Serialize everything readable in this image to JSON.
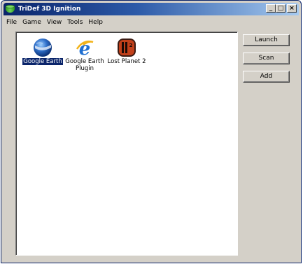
{
  "window": {
    "title": "TriDef 3D Ignition",
    "controls": {
      "minimize": "_",
      "maximize": "□",
      "close": "×"
    }
  },
  "menu": [
    "File",
    "Game",
    "View",
    "Tools",
    "Help"
  ],
  "games": [
    {
      "label": "Google Earth",
      "icon": "google-earth-icon",
      "selected": true
    },
    {
      "label": "Google Earth Plugin",
      "icon": "internet-explorer-icon",
      "selected": false
    },
    {
      "label": "Lost Planet 2",
      "icon": "lost-planet-2-icon",
      "selected": false
    }
  ],
  "buttons": {
    "launch": "Launch",
    "scan": "Scan",
    "add": "Add"
  },
  "colors": {
    "title_bar": "#0a246a",
    "selection": "#0a246a",
    "window_bg": "#d4d0c8"
  }
}
